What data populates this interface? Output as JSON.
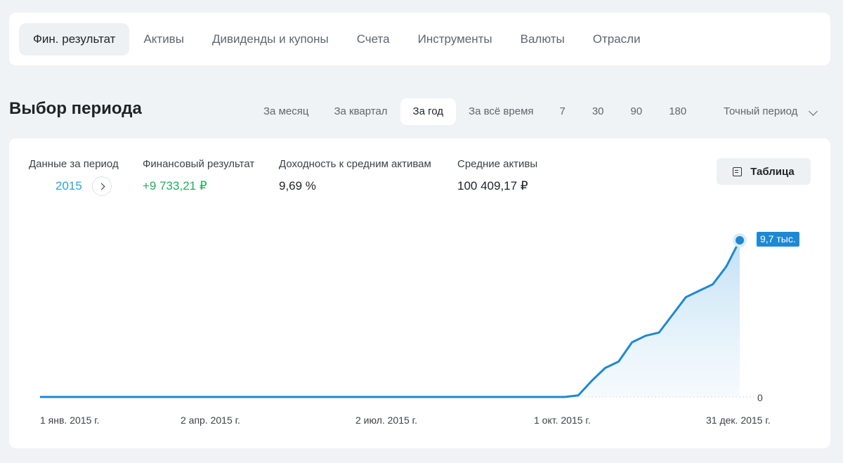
{
  "tabs": [
    {
      "label": "Фин. результат",
      "active": true
    },
    {
      "label": "Активы",
      "active": false
    },
    {
      "label": "Дивиденды и купоны",
      "active": false
    },
    {
      "label": "Счета",
      "active": false
    },
    {
      "label": "Инструменты",
      "active": false
    },
    {
      "label": "Валюты",
      "active": false
    },
    {
      "label": "Отрасли",
      "active": false
    }
  ],
  "period": {
    "title": "Выбор периода",
    "buttons": [
      {
        "label": "За месяц",
        "active": false
      },
      {
        "label": "За квартал",
        "active": false
      },
      {
        "label": "За год",
        "active": true
      },
      {
        "label": "За всё время",
        "active": false
      }
    ],
    "days": [
      "7",
      "30",
      "90",
      "180"
    ],
    "exact_label": "Точный период"
  },
  "stats": {
    "period_label": "Данные за период",
    "period_value": "2015",
    "result_label": "Финансовый результат",
    "result_value": "+9 733,21 ₽",
    "yield_label": "Доходность к средним активам",
    "yield_value": "9,69 %",
    "avg_label": "Средние активы",
    "avg_value": "100 409,17 ₽"
  },
  "table_button": "Таблица",
  "colors": {
    "accent": "#2aa3dc",
    "positive": "#1fae5b",
    "line": "#1e88d4",
    "tooltip_bg": "#1e88d4"
  },
  "chart_data": {
    "type": "area",
    "x": [
      "2015-01-01",
      "2015-04-02",
      "2015-07-02",
      "2015-10-01",
      "2015-10-08",
      "2015-10-15",
      "2015-10-22",
      "2015-10-29",
      "2015-11-05",
      "2015-11-12",
      "2015-11-19",
      "2015-11-26",
      "2015-12-03",
      "2015-12-10",
      "2015-12-17",
      "2015-12-24",
      "2015-12-31"
    ],
    "values": [
      0,
      0,
      0,
      0,
      100,
      1000,
      1800,
      2200,
      3400,
      3800,
      4000,
      5100,
      6200,
      6600,
      7000,
      8100,
      9733
    ],
    "x_tick_labels": [
      "1 янв. 2015 г.",
      "2 апр. 2015 г.",
      "2 июл. 2015 г.",
      "1 окт. 2015 г.",
      "31 дек. 2015 г."
    ],
    "y_tick_labels": [
      "0"
    ],
    "last_value_label": "9,7 тыс.",
    "ylim": [
      0,
      9733
    ],
    "grid": false,
    "legend": "none"
  }
}
